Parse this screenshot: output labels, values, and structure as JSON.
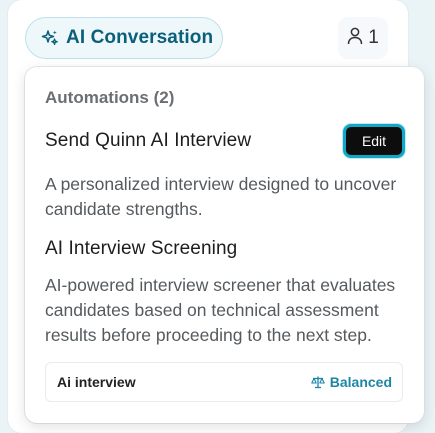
{
  "node": {
    "title": "AI Conversation",
    "icon": "sparkles-icon",
    "count": "1",
    "count_icon": "user-icon"
  },
  "popover": {
    "section_title": "Automations (2)",
    "automations": [
      {
        "name": "Send Quinn AI Interview",
        "description": "A personalized interview designed to uncover candidate strengths.",
        "edit_label": "Edit"
      },
      {
        "name": "AI Interview Screening",
        "description": "AI-powered interview screener that evaluates candidates based on technical assessment results before proceeding to the next step."
      }
    ],
    "footer": {
      "left": "Ai interview",
      "right": "Balanced",
      "right_icon": "scale-icon"
    }
  },
  "colors": {
    "accent": "#0b5f7a",
    "edit_border": "#12a7c7",
    "balanced": "#1d86a6"
  }
}
